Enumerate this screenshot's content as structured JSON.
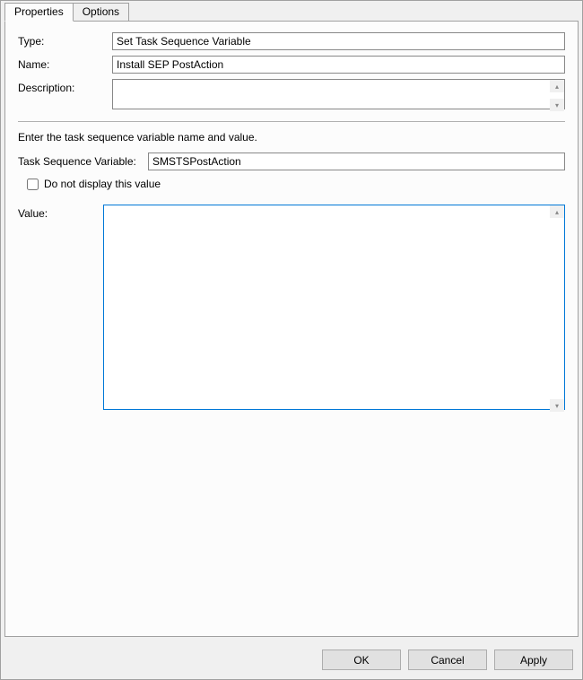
{
  "tabs": {
    "properties": "Properties",
    "options": "Options"
  },
  "labels": {
    "type": "Type:",
    "name": "Name:",
    "description": "Description:",
    "taskVar": "Task Sequence Variable:",
    "value": "Value:",
    "doNotDisplay": "Do not display this value"
  },
  "fields": {
    "type": "Set Task Sequence Variable",
    "name": "Install SEP PostAction",
    "description": "",
    "taskVar": "SMSTSPostAction",
    "value": ""
  },
  "instruction": "Enter the task sequence variable name and value.",
  "buttons": {
    "ok": "OK",
    "cancel": "Cancel",
    "apply": "Apply"
  }
}
